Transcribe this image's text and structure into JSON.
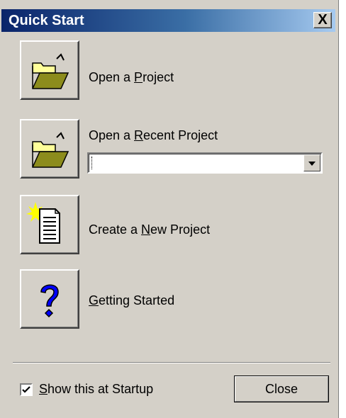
{
  "window": {
    "title": "Quick Start",
    "close_glyph": "X"
  },
  "actions": [
    {
      "label_pre": "Open a ",
      "label_key": "P",
      "label_post": "roject",
      "icon": "open-folder-icon"
    },
    {
      "label_pre": "Open a ",
      "label_key": "R",
      "label_post": "ecent Project",
      "icon": "open-folder-icon"
    },
    {
      "label_pre": "Create a ",
      "label_key": "N",
      "label_post": "ew Project",
      "icon": "new-document-icon"
    },
    {
      "label_pre": "",
      "label_key": "G",
      "label_post": "etting Started",
      "icon": "help-question-icon"
    }
  ],
  "recent_project": {
    "value": ""
  },
  "footer": {
    "show_at_startup_checked": true,
    "show_label_key": "S",
    "show_label_post": "how this at Startup",
    "close_label": "Close"
  },
  "colors": {
    "title_gradient_start": "#0a246a",
    "title_gradient_end": "#a6caf0",
    "dialog_bg": "#d4d0c8",
    "folder_fill": "#8c8c1c",
    "help_blue": "#0000ff"
  }
}
